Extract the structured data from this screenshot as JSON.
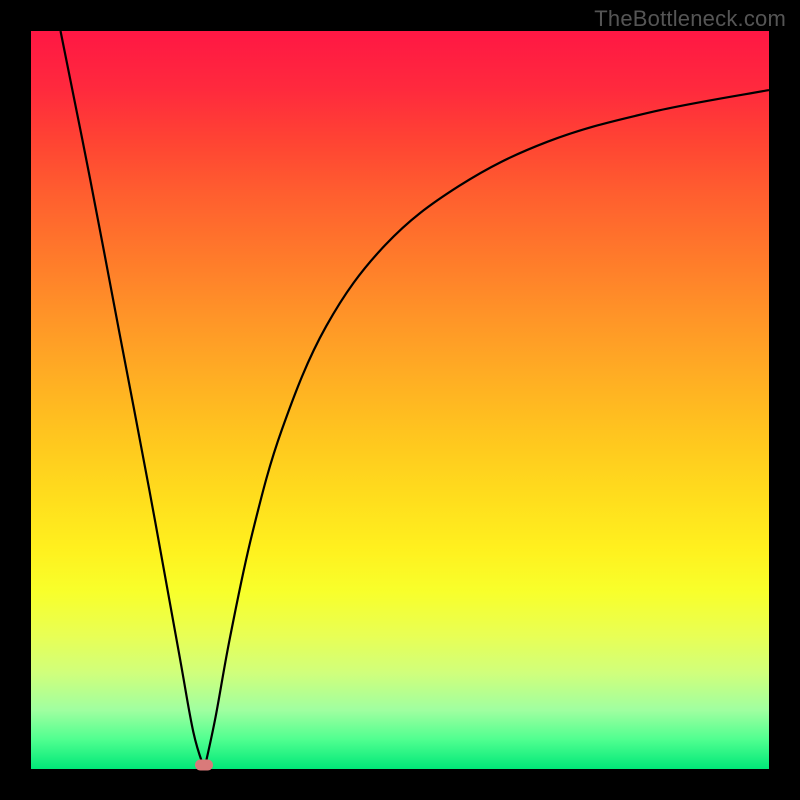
{
  "watermark": "TheBottleneck.com",
  "chart_data": {
    "type": "line",
    "title": "",
    "xlabel": "",
    "ylabel": "",
    "xlim": [
      0,
      100
    ],
    "ylim": [
      0,
      100
    ],
    "gradient_colors": {
      "top": "#ff1744",
      "mid_high": "#ff9228",
      "mid": "#ffda1d",
      "mid_low": "#e8ff55",
      "bottom": "#00e878"
    },
    "series": [
      {
        "name": "left-branch",
        "x": [
          4,
          8,
          12,
          16,
          20,
          22,
          23.5
        ],
        "y": [
          100,
          80,
          59,
          38,
          16,
          5,
          0
        ]
      },
      {
        "name": "right-branch",
        "x": [
          23.5,
          25,
          27,
          30,
          34,
          40,
          48,
          58,
          70,
          84,
          100
        ],
        "y": [
          0,
          7,
          18,
          32,
          46,
          60,
          71,
          79,
          85,
          89,
          92
        ]
      }
    ],
    "marker": {
      "x": 23.5,
      "y": 0.5,
      "color": "#d97a7a"
    }
  }
}
